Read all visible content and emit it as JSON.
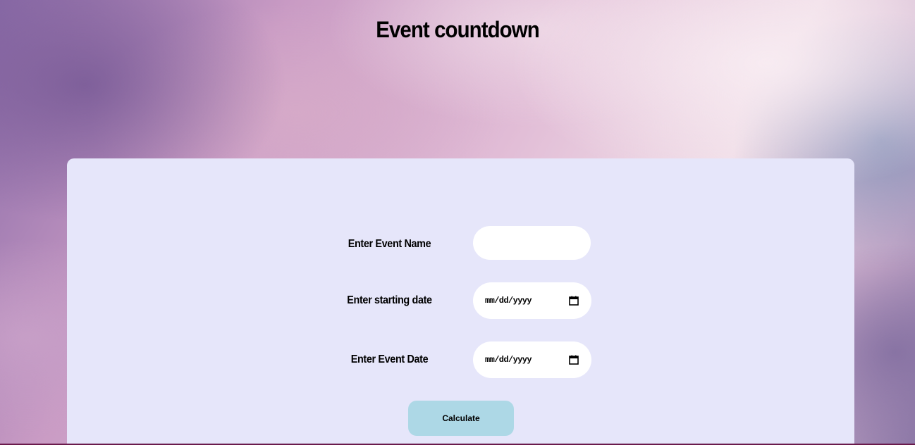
{
  "page": {
    "title": "Event countdown"
  },
  "form": {
    "event_name": {
      "label": "Enter Event Name",
      "value": ""
    },
    "start_date": {
      "label": "Enter starting date",
      "placeholder": "mm/dd/yyyy",
      "icon": "calendar-icon"
    },
    "event_date": {
      "label": "Enter Event Date",
      "placeholder": "mm/dd/yyyy",
      "icon": "calendar-icon"
    },
    "calculate_label": "Calculate"
  },
  "colors": {
    "card_background": "#e6e6fa",
    "button_background": "#add8e6",
    "input_background": "#ffffff"
  }
}
